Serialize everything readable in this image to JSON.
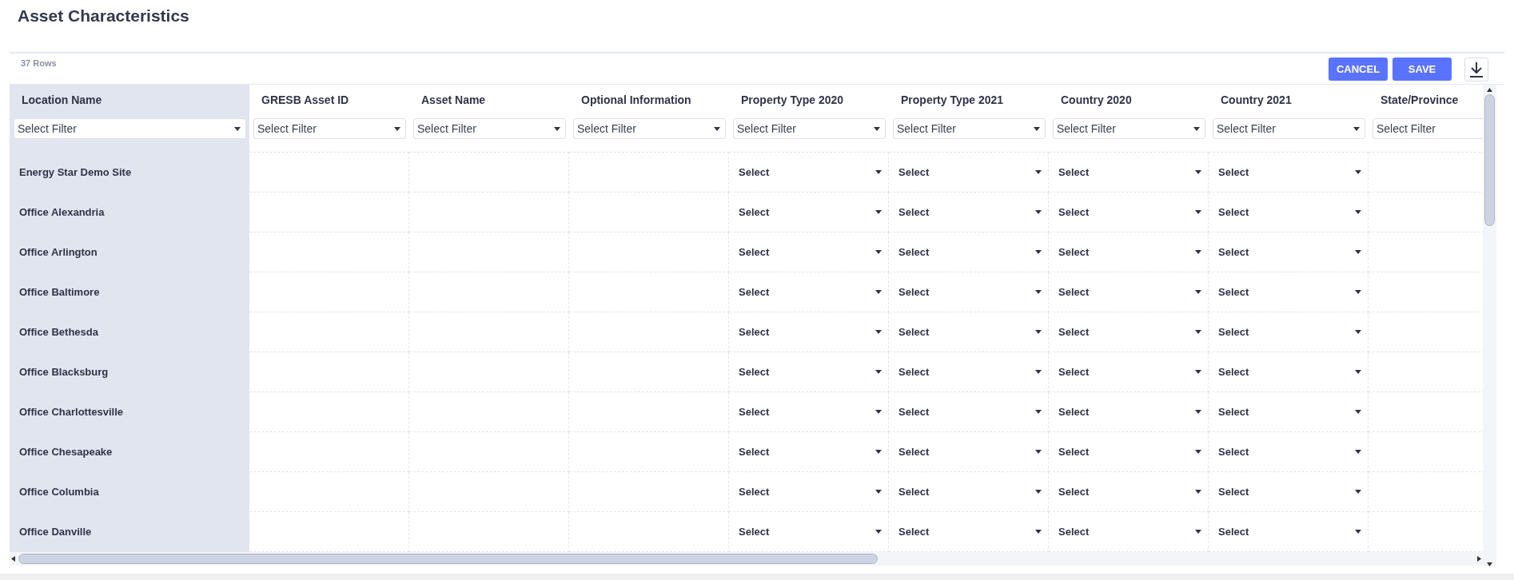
{
  "page": {
    "title": "Asset Characteristics"
  },
  "toolbar": {
    "row_count": "37 Rows",
    "buttons": [
      "CANCEL",
      "SAVE"
    ]
  },
  "columns": [
    {
      "label": "Location Name",
      "kind": "location",
      "filter_placeholder": "Select Filter"
    },
    {
      "label": "GRESB Asset ID",
      "kind": "text",
      "filter_placeholder": "Select Filter"
    },
    {
      "label": "Asset Name",
      "kind": "text",
      "filter_placeholder": "Select Filter"
    },
    {
      "label": "Optional Information",
      "kind": "text",
      "filter_placeholder": "Select Filter"
    },
    {
      "label": "Property Type 2020",
      "kind": "select",
      "filter_placeholder": "Select Filter"
    },
    {
      "label": "Property Type 2021",
      "kind": "select",
      "filter_placeholder": "Select Filter"
    },
    {
      "label": "Country 2020",
      "kind": "select",
      "filter_placeholder": "Select Filter"
    },
    {
      "label": "Country 2021",
      "kind": "select",
      "filter_placeholder": "Select Filter"
    },
    {
      "label": "State/Province",
      "kind": "text",
      "filter_placeholder": "Select Filter"
    }
  ],
  "rows": [
    {
      "location_name": "Energy Star Demo Site",
      "selects": [
        "Select",
        "Select",
        "Select",
        "Select"
      ]
    },
    {
      "location_name": "Office Alexandria",
      "selects": [
        "Select",
        "Select",
        "Select",
        "Select"
      ]
    },
    {
      "location_name": "Office Arlington",
      "selects": [
        "Select",
        "Select",
        "Select",
        "Select"
      ]
    },
    {
      "location_name": "Office Baltimore",
      "selects": [
        "Select",
        "Select",
        "Select",
        "Select"
      ]
    },
    {
      "location_name": "Office Bethesda",
      "selects": [
        "Select",
        "Select",
        "Select",
        "Select"
      ]
    },
    {
      "location_name": "Office Blacksburg",
      "selects": [
        "Select",
        "Select",
        "Select",
        "Select"
      ]
    },
    {
      "location_name": "Office Charlottesville",
      "selects": [
        "Select",
        "Select",
        "Select",
        "Select"
      ]
    },
    {
      "location_name": "Office Chesapeake",
      "selects": [
        "Select",
        "Select",
        "Select",
        "Select"
      ]
    },
    {
      "location_name": "Office Columbia",
      "selects": [
        "Select",
        "Select",
        "Select",
        "Select"
      ]
    },
    {
      "location_name": "Office Danville",
      "selects": [
        "Select",
        "Select",
        "Select",
        "Select"
      ]
    }
  ]
}
